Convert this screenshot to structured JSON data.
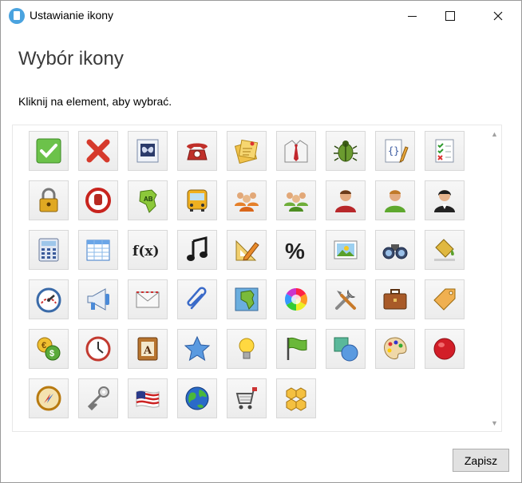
{
  "window": {
    "title": "Ustawianie ikony"
  },
  "heading": "Wybór ikony",
  "instruction": "Kliknij na element, aby wybrać.",
  "icons": [
    "checkmark-icon",
    "cross-icon",
    "butterfly-document-icon",
    "telephone-icon",
    "sticky-notes-icon",
    "shirt-tie-icon",
    "bug-icon",
    "code-file-pencil-icon",
    "checklist-icon",
    "padlock-icon",
    "stop-hand-icon",
    "africa-map-ab-icon",
    "bus-icon",
    "group-orange-icon",
    "group-green-icon",
    "person-red-icon",
    "person-green-icon",
    "person-woman-icon",
    "calculator-icon",
    "table-grid-icon",
    "function-fx-icon",
    "music-note-icon",
    "ruler-pencil-icon",
    "percent-icon",
    "landscape-picture-icon",
    "binoculars-icon",
    "paint-bucket-icon",
    "speedometer-icon",
    "megaphone-icon",
    "envelope-icon",
    "paperclip-icon",
    "africa-map-icon",
    "color-wheel-icon",
    "tools-icon",
    "briefcase-icon",
    "price-tag-icon",
    "currency-coins-icon",
    "clock-icon",
    "address-book-icon",
    "star-icon",
    "lightbulb-icon",
    "flag-icon",
    "shapes-icon",
    "palette-icon",
    "red-ball-icon",
    "compass-icon",
    "keys-icon",
    "us-flag-icon",
    "globe-icon",
    "shopping-cart-icon",
    "honeycomb-icon"
  ],
  "texts": {
    "fx": "f(x)",
    "percent": "%",
    "ab": "AB",
    "book": "A"
  },
  "save_label": "Zapisz"
}
